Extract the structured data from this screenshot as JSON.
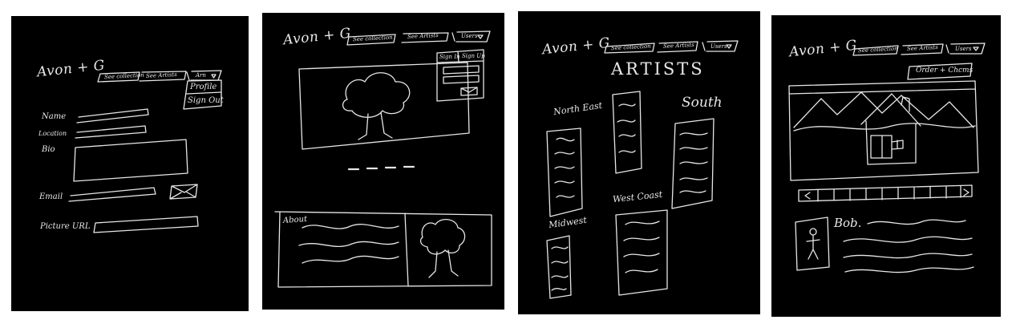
{
  "brand": "Avon + G",
  "nav": {
    "see_collection": "See collection",
    "see_artists": "See Artists",
    "user_short": "Arn",
    "user": "Users"
  },
  "profile_screen": {
    "menu": {
      "profile": "Profile",
      "sign_out": "Sign Out"
    },
    "fields": {
      "name": "Name",
      "location": "Location",
      "bio": "Bio",
      "email": "Email",
      "picture_url": "Picture URL"
    }
  },
  "home_screen": {
    "auth": {
      "sign_in": "Sign In",
      "sign_up": "Sign Up"
    },
    "about_label": "About"
  },
  "artists_screen": {
    "title": "ARTISTS",
    "regions": {
      "north_east": "North East",
      "south": "South",
      "west_coast": "West Coast",
      "midwest": "Midwest"
    }
  },
  "artist_screen": {
    "order_button": "Order + Chcms",
    "artist_name": "Bob."
  }
}
